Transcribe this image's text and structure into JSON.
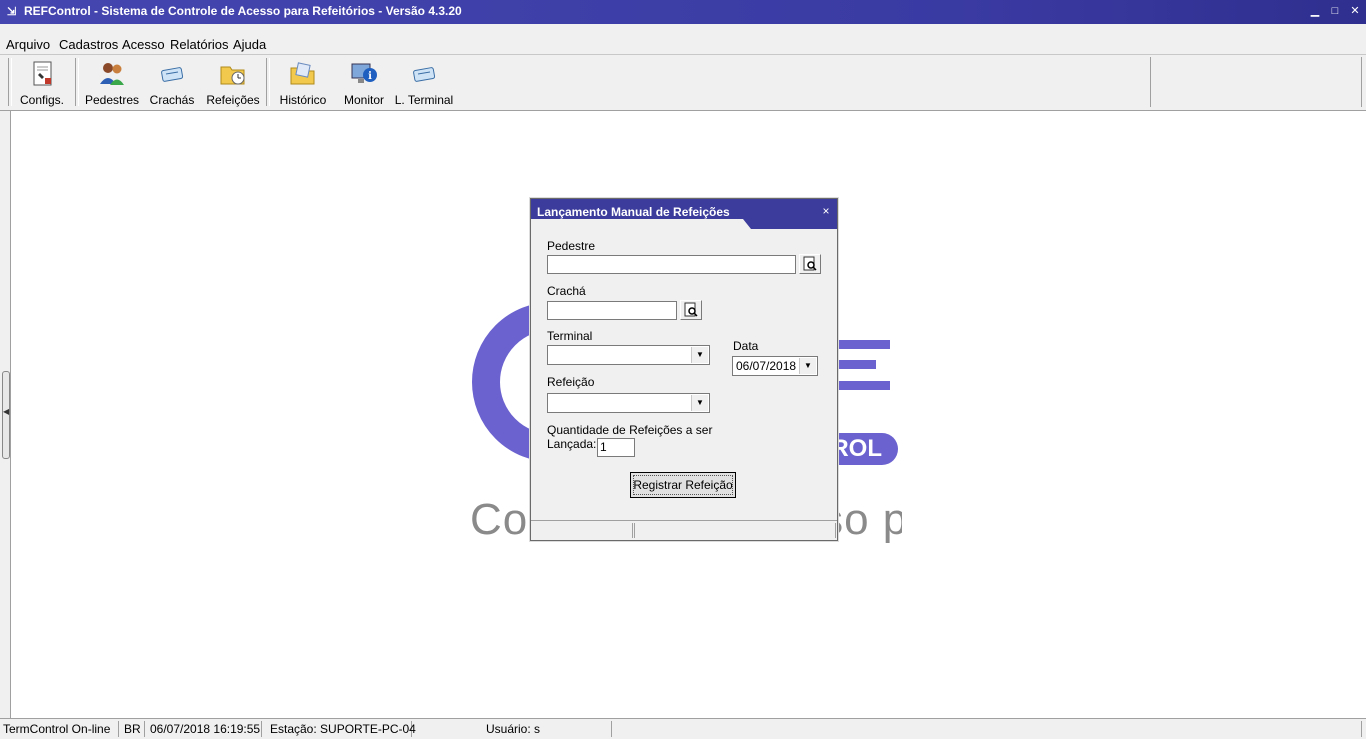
{
  "window": {
    "title": "REFControl - Sistema de Controle de Acesso para Refeitórios - Versão 4.3.20",
    "controls": {
      "minimize": "▁",
      "maximize": "□",
      "close": "✕"
    }
  },
  "menu": [
    "Arquivo",
    "Cadastros",
    "Acesso",
    "Relatórios",
    "Ajuda"
  ],
  "toolbar": {
    "buttons": [
      {
        "label": "Configs.",
        "icon": "config-document-icon"
      },
      {
        "label": "Pedestres",
        "icon": "people-icon"
      },
      {
        "label": "Crachás",
        "icon": "badge-card-icon"
      },
      {
        "label": "Refeições",
        "icon": "folder-clock-icon"
      },
      {
        "label": "Histórico",
        "icon": "history-folder-icon"
      },
      {
        "label": "Monitor",
        "icon": "monitor-info-icon"
      },
      {
        "label": "L. Terminal",
        "icon": "terminal-card-icon"
      }
    ]
  },
  "background_logo": {
    "pill_text": "ROL",
    "subtitle": "Controle de Acesso para Refeitórios"
  },
  "dialog": {
    "title": "Lançamento Manual de Refeições",
    "close": "×",
    "fields": {
      "pedestre_label": "Pedestre",
      "pedestre_value": "",
      "cracha_label": "Crachá",
      "cracha_value": "",
      "terminal_label": "Terminal",
      "terminal_value": "",
      "data_label": "Data",
      "data_value": "06/07/2018",
      "refeicao_label": "Refeição",
      "refeicao_value": "",
      "quantidade_label_line1": "Quantidade de Refeições a ser",
      "quantidade_label_line2": "Lançada:",
      "quantidade_value": "1"
    },
    "register_button": "Registrar Refeição"
  },
  "statusbar": {
    "connection": "TermControl On-line",
    "locale": "BR",
    "datetime": "06/07/2018 16:19:55",
    "station": "Estação: SUPORTE-PC-04",
    "user": "Usuário: s"
  },
  "colors": {
    "titlebar": "#3a3aa3",
    "logo_accent": "#6b62cf",
    "dialog_title": "#3c3c9c"
  }
}
